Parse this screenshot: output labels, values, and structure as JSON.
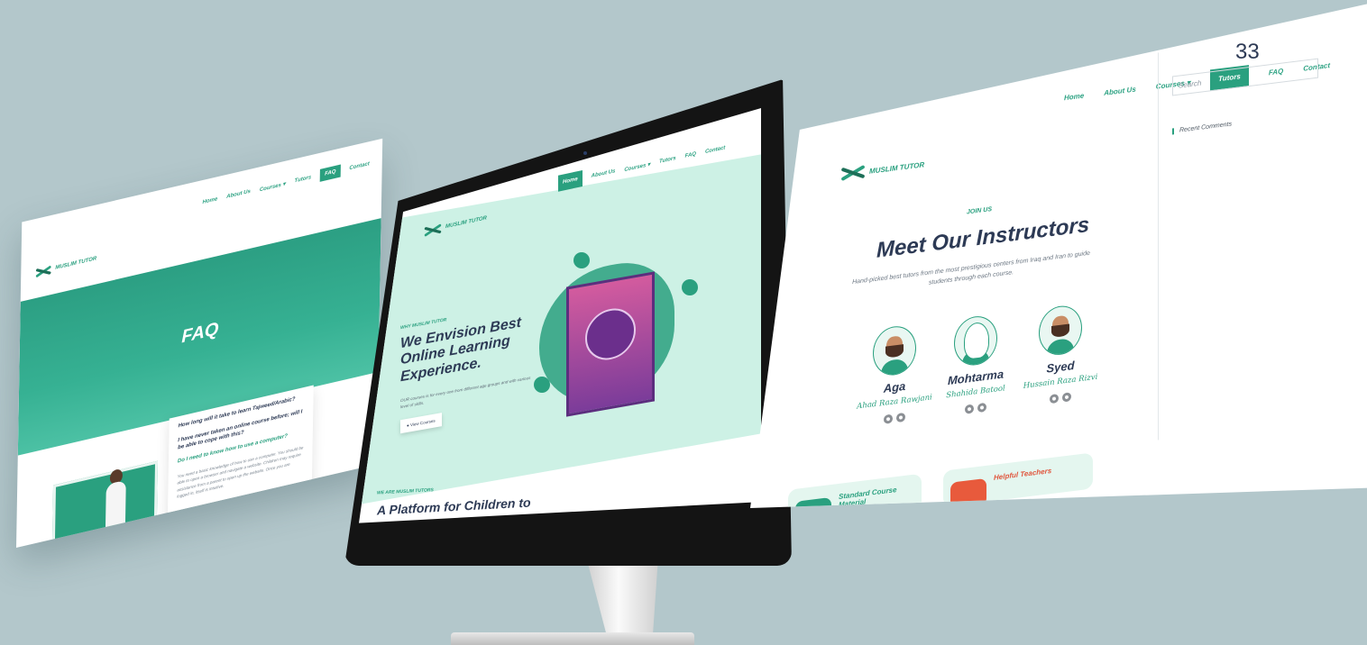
{
  "brand": "MUSLIM TUTOR",
  "colors": {
    "background": "#b3c7cb",
    "accent": "#2aa07f",
    "dark_text": "#2d3a55",
    "hero_mint": "#cdf1e5"
  },
  "faq_page": {
    "nav": [
      "Home",
      "About Us",
      "Courses",
      "Tutors",
      "FAQ",
      "Contact"
    ],
    "active_nav": "FAQ",
    "title": "FAQ",
    "questions": [
      "How long will it take to learn Tajweed/Arabic?",
      "I have never taken an online course before; will I be able to cope with this?",
      "Do I need to know how to use a computer?"
    ],
    "answer": "You need a basic knowledge of how to use a computer. You should be able to open a browser and navigate a website. Children may require assistance from a parent to open up the website. Once you are logged in, itself is intuitive."
  },
  "home_page": {
    "nav": [
      "Home",
      "About Us",
      "Courses",
      "Tutors",
      "FAQ",
      "Contact"
    ],
    "active_nav": "Home",
    "eyebrow": "WHY MUSLIM TUTOR",
    "title": "We Envision Best Online Learning Experience.",
    "description": "OUR courses is for every one from different age groups and with various level of skills.",
    "button_label": "View Courses",
    "section_eyebrow": "WE ARE MUSLIM TUTORS",
    "section_title": "A Platform for Children to"
  },
  "tutors_page": {
    "nav": [
      "Home",
      "About Us",
      "Courses",
      "Tutors",
      "FAQ",
      "Contact"
    ],
    "active_nav": "Tutors",
    "overlay_number": "33",
    "eyebrow": "JOIN US",
    "title": "Meet Our Instructors",
    "description": "Hand-picked best tutors from the most prestigious centers from Iraq and Iran to guide students through each course.",
    "search_placeholder": "Search",
    "recent_comments": "Recent Comments",
    "tutors": [
      {
        "name": "Aga",
        "fullname": "Ahad Raza Rawjani"
      },
      {
        "name": "Mohtarma",
        "fullname": "Shahida Batool"
      },
      {
        "name": "Syed",
        "fullname": "Hussain Raza Rizvi"
      }
    ],
    "features": [
      "Standard Course Material",
      "Helpful Teachers"
    ]
  }
}
